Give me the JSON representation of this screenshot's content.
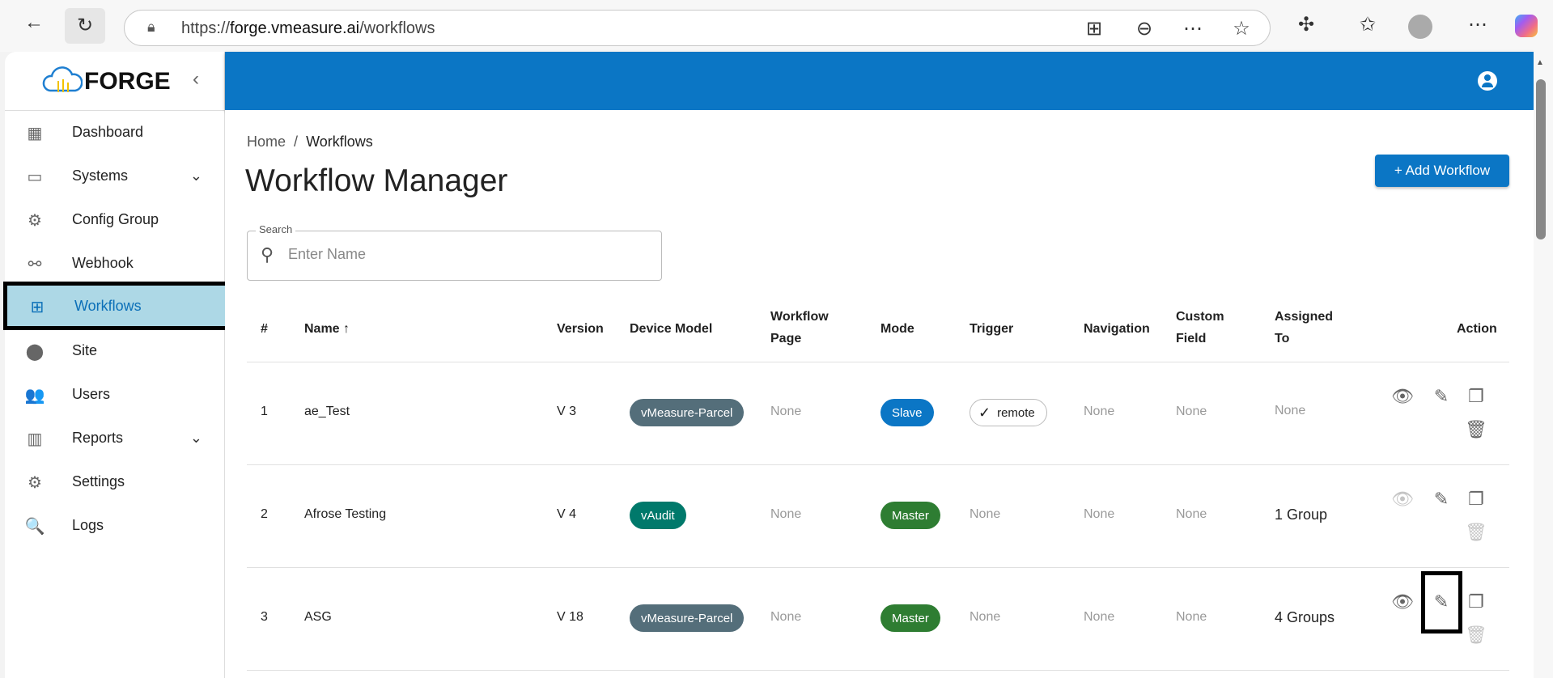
{
  "browser": {
    "url_prefix": "https://",
    "url_domain": "forge.vmeasure.ai",
    "url_path": "/workflows"
  },
  "sidebar": {
    "brand": "FORGE",
    "items": [
      {
        "label": "Dashboard",
        "icon": "dashboard-icon",
        "glyph": "▦"
      },
      {
        "label": "Systems",
        "icon": "devices-icon",
        "glyph": "▭",
        "expand": true
      },
      {
        "label": "Config Group",
        "icon": "gears-icon",
        "glyph": "⚙"
      },
      {
        "label": "Webhook",
        "icon": "webhook-icon",
        "glyph": "⚯"
      },
      {
        "label": "Workflows",
        "icon": "workflow-icon",
        "glyph": "⊞",
        "active": true
      },
      {
        "label": "Site",
        "icon": "location-icon",
        "glyph": "⬤"
      },
      {
        "label": "Users",
        "icon": "users-icon",
        "glyph": "👥"
      },
      {
        "label": "Reports",
        "icon": "reports-icon",
        "glyph": "▥",
        "expand": true
      },
      {
        "label": "Settings",
        "icon": "settings-icon",
        "glyph": "⚙"
      },
      {
        "label": "Logs",
        "icon": "logs-icon",
        "glyph": "🔍"
      }
    ]
  },
  "breadcrumb": {
    "home": "Home",
    "sep": "/",
    "current": "Workflows"
  },
  "page_title": "Workflow Manager",
  "add_button": "+ Add Workflow",
  "search": {
    "label": "Search",
    "placeholder": "Enter Name"
  },
  "table": {
    "headers": [
      "#",
      "Name ↑",
      "Version",
      "Device Model",
      "Workflow Page",
      "Mode",
      "Trigger",
      "Navigation",
      "Custom Field",
      "Assigned To",
      "Action"
    ],
    "rows": [
      {
        "num": "1",
        "name": "ae_Test",
        "version": "V 3",
        "device": "vMeasure-Parcel",
        "device_color": "#546e7a",
        "page": "None",
        "mode": "Slave",
        "mode_color": "#0b76c5",
        "trigger": "remote",
        "navigation": "None",
        "custom": "None",
        "assigned": "None",
        "assigned_none": true,
        "view_enabled": true,
        "delete_enabled": true
      },
      {
        "num": "2",
        "name": "Afrose Testing",
        "version": "V 4",
        "device": "vAudit",
        "device_color": "#00796b",
        "page": "None",
        "mode": "Master",
        "mode_color": "#2e7d32",
        "trigger": "None",
        "navigation": "None",
        "custom": "None",
        "assigned": "1 Group",
        "assigned_none": false,
        "view_enabled": false,
        "delete_enabled": false
      },
      {
        "num": "3",
        "name": "ASG",
        "version": "V 18",
        "device": "vMeasure-Parcel",
        "device_color": "#546e7a",
        "page": "None",
        "mode": "Master",
        "mode_color": "#2e7d32",
        "trigger": "None",
        "navigation": "None",
        "custom": "None",
        "assigned": "4 Groups",
        "assigned_none": false,
        "view_enabled": true,
        "delete_enabled": false
      }
    ]
  }
}
